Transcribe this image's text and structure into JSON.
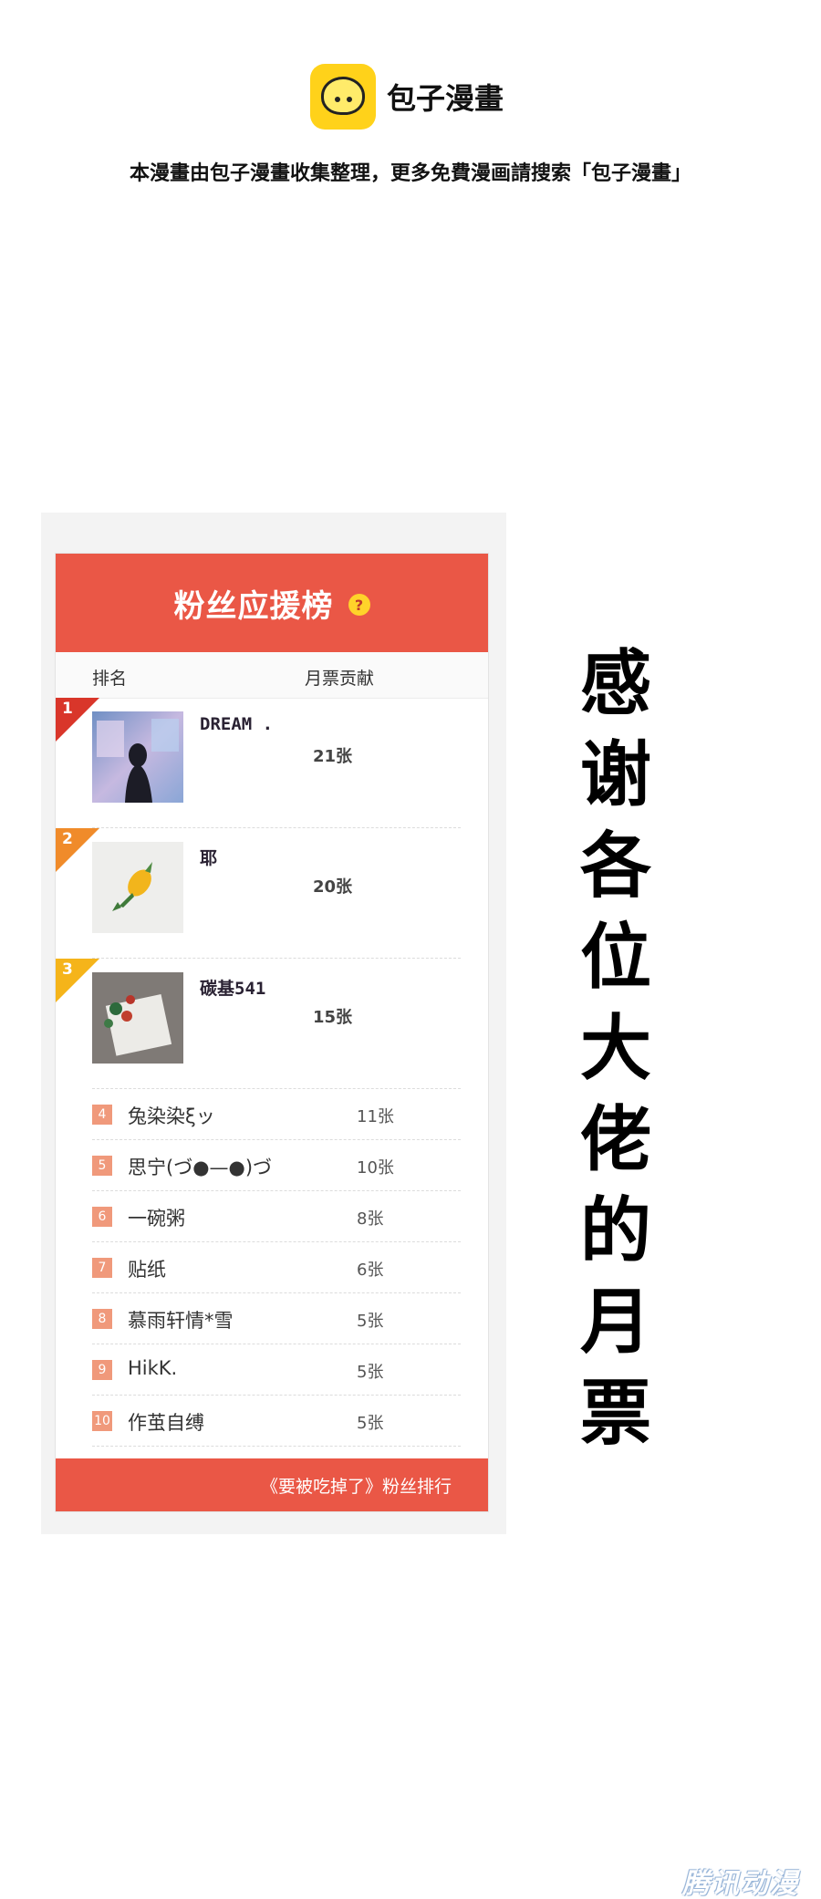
{
  "header": {
    "brand_name": "包子漫畫",
    "notice": "本漫畫由包子漫畫收集整理，更多免費漫画請搜索「包子漫畫」"
  },
  "card": {
    "title": "粉丝应援榜",
    "help_icon": "?",
    "col_rank": "排名",
    "col_votes": "月票贡献",
    "top3": [
      {
        "rank": "1",
        "name": "DREAM .",
        "count": "21张",
        "color": "#d9362a"
      },
      {
        "rank": "2",
        "name": "耶",
        "count": "20张",
        "color": "#f08b2a"
      },
      {
        "rank": "3",
        "name": "碳基541",
        "count": "15张",
        "color": "#f5b41a"
      }
    ],
    "rest": [
      {
        "rank": "4",
        "name": "兔染染ξッ",
        "count": "11张"
      },
      {
        "rank": "5",
        "name": "思宁(づ●—●)づ",
        "count": "10张"
      },
      {
        "rank": "6",
        "name": "一碗粥",
        "count": "8张"
      },
      {
        "rank": "7",
        "name": "贴纸",
        "count": "6张"
      },
      {
        "rank": "8",
        "name": "慕雨轩情*雪",
        "count": "5张"
      },
      {
        "rank": "9",
        "name": "HikK.",
        "count": "5张"
      },
      {
        "rank": "10",
        "name": "作茧自缚",
        "count": "5张"
      }
    ],
    "footer": "《要被吃掉了》粉丝排行"
  },
  "thanks": [
    "感",
    "谢",
    "各",
    "位",
    "大",
    "佬",
    "的",
    "月",
    "票"
  ],
  "watermark": "腾讯动漫",
  "colors": {
    "accent_red": "#ea5746",
    "badge_orange": "#f0997b",
    "brand_yellow": "#ffd21a"
  }
}
